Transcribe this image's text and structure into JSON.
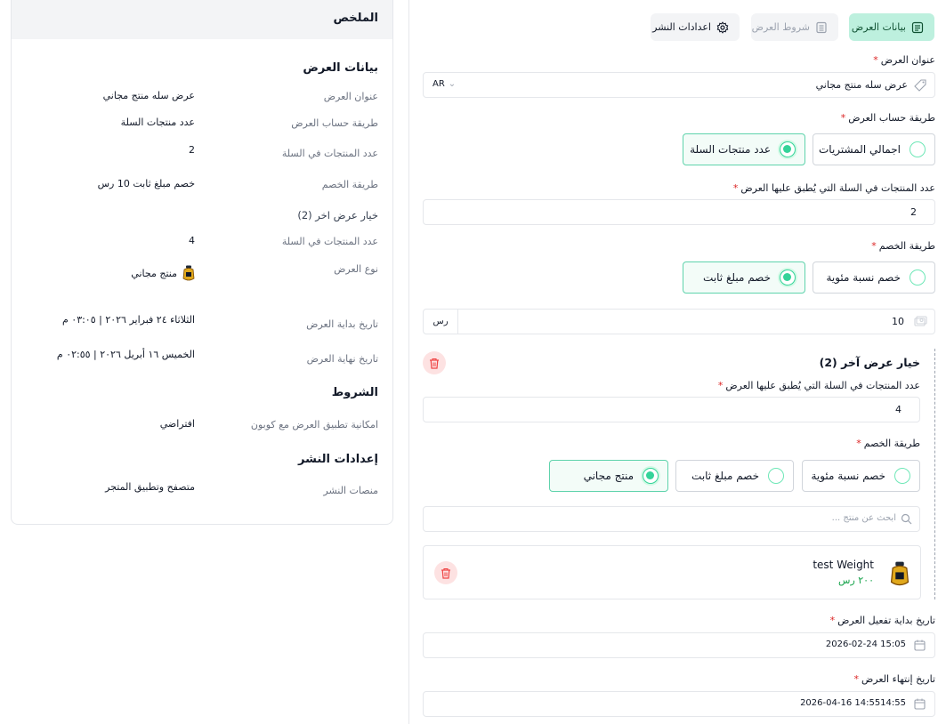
{
  "summary": {
    "title": "الملخص",
    "offer_section": "بيانات العرض",
    "rows": [
      {
        "label": "عنوان العرض",
        "value": "عرض سله منتج مجاني"
      },
      {
        "label": "طريقة حساب العرض",
        "value": "عدد منتجات السلة"
      },
      {
        "label": "عدد المنتجات في السلة",
        "value": "2"
      },
      {
        "label": "طريقة الخصم",
        "value": "خصم مبلغ ثابت 10 رس"
      }
    ],
    "other_option_title": "خيار عرض اخر (2)",
    "other_rows": [
      {
        "label": "عدد المنتجات في السلة",
        "value": "4"
      },
      {
        "label": "نوع العرض",
        "value": "منتج مجاني"
      }
    ],
    "date_rows": [
      {
        "label": "تاريخ بداية العرض",
        "value": "الثلاثاء ٢٤ فبراير ٢٠٢٦ | ٠٣:٠٥ م"
      },
      {
        "label": "تاريخ نهاية العرض",
        "value": "الخميس ١٦ أبريل ٢٠٢٦ | ٠٢:٥٥ م"
      }
    ],
    "conditions_section": "الشروط",
    "conditions_rows": [
      {
        "label": "امكانية تطبيق العرض مع كوبون",
        "value": "افتراضي"
      }
    ],
    "publish_section": "إعدادات النشر",
    "publish_rows": [
      {
        "label": "منصات النشر",
        "value": "متصفح وتطبيق المتجر"
      }
    ]
  },
  "tabs": [
    {
      "label": "بيانات العرض",
      "icon": "document-icon",
      "state": "active"
    },
    {
      "label": "شروط العرض",
      "icon": "list-icon",
      "state": "disabled"
    },
    {
      "label": "اعدادات النشر",
      "icon": "gear-icon",
      "state": "normal"
    }
  ],
  "form": {
    "title_label": "عنوان العرض",
    "title_value": "عرض سله منتج مجاني",
    "lang": "AR",
    "calc_label": "طريقة حساب العرض",
    "calc_options": [
      "اجمالي المشتريات",
      "عدد منتجات السلة"
    ],
    "calc_selected": "عدد منتجات السلة",
    "count_label": "عدد المنتجات في السلة التي يُطبق عليها العرض",
    "count_value": "2",
    "discount_label": "طريقة الخصم",
    "discount_options": [
      "خصم نسبة مئوية",
      "خصم مبلغ ثابت"
    ],
    "discount_selected": "خصم مبلغ ثابت",
    "amount_value": "10",
    "currency": "رس",
    "option2": {
      "title": "خيار عرض آخر (2)",
      "count_label": "عدد المنتجات في السلة التي يُطبق عليها العرض",
      "count_value": "4",
      "discount_label": "طريقة الخصم",
      "discount_options": [
        "خصم نسبة مئوية",
        "خصم مبلغ ثابت",
        "منتج مجاني"
      ],
      "discount_selected": "منتج مجاني",
      "search_placeholder": "ابحث عن منتج ...",
      "product_name": "test Weight",
      "product_price": "٢٠٠ رس"
    },
    "start_label": "تاريخ بداية تفعيل العرض",
    "start_value": "2026-02-24 15:05",
    "end_label": "تاريخ إنتهاء العرض",
    "end_value": "2026-04-16 14:5514:55"
  },
  "colors": {
    "accent": "#34d399",
    "accent_bg": "#bdf0de",
    "danger": "#dc2626",
    "price": "#16a34a"
  }
}
